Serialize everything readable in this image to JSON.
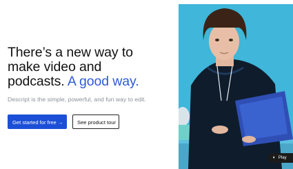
{
  "hero": {
    "headline_line1": "There’s a new way to",
    "headline_line2": "make video and",
    "headline_line3_start": "podcasts. ",
    "headline_accent": "A good way.",
    "subhead": "Descript is the simple, powerful, and fun way to edit."
  },
  "cta": {
    "primary_label": "Get started for free →",
    "secondary_label": "See product tour"
  },
  "video": {
    "play_label": "Play",
    "audio_icon": "speaker-icon",
    "background_color": "#3fb6da"
  },
  "colors": {
    "accent": "#2f5ad9",
    "primary_button": "#1c4fd8"
  }
}
